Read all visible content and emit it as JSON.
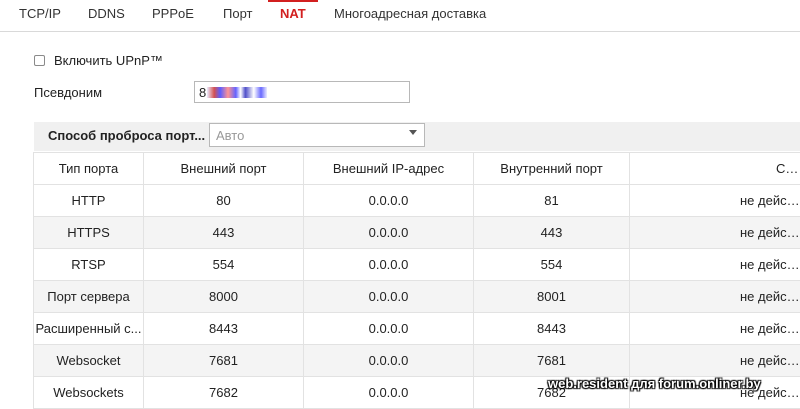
{
  "tabs": [
    {
      "label": "TCP/IP",
      "active": false
    },
    {
      "label": "DDNS",
      "active": false
    },
    {
      "label": "PPPoE",
      "active": false
    },
    {
      "label": "Порт",
      "active": false
    },
    {
      "label": "NAT",
      "active": true
    },
    {
      "label": "Многоадресная доставка",
      "active": false
    }
  ],
  "upnp": {
    "label": "Включить UPnP™",
    "checked": false
  },
  "alias": {
    "label": "Псевдоним",
    "value": "8"
  },
  "mapping": {
    "label": "Способ проброса порт...",
    "selected": "Авто"
  },
  "table": {
    "headers": [
      "Тип порта",
      "Внешний порт",
      "Внешний IP-адрес",
      "Внутренний порт",
      "Статус"
    ],
    "rows": [
      [
        "HTTP",
        "80",
        "0.0.0.0",
        "81",
        "не действительный"
      ],
      [
        "HTTPS",
        "443",
        "0.0.0.0",
        "443",
        "не действительный"
      ],
      [
        "RTSP",
        "554",
        "0.0.0.0",
        "554",
        "не действительный"
      ],
      [
        "Порт сервера",
        "8000",
        "0.0.0.0",
        "8001",
        "не действительный"
      ],
      [
        "Расширенный с...",
        "8443",
        "0.0.0.0",
        "8443",
        "не действительный"
      ],
      [
        "Websocket",
        "7681",
        "0.0.0.0",
        "7681",
        "не действительный"
      ],
      [
        "Websockets",
        "7682",
        "0.0.0.0",
        "7682",
        "не действительный"
      ]
    ]
  },
  "watermark": "web.resident для forum.onliner.by",
  "colors": {
    "accent": "#d21f1f",
    "alt_row": "#f4f4f4",
    "section_bg": "#f0f0f0"
  }
}
